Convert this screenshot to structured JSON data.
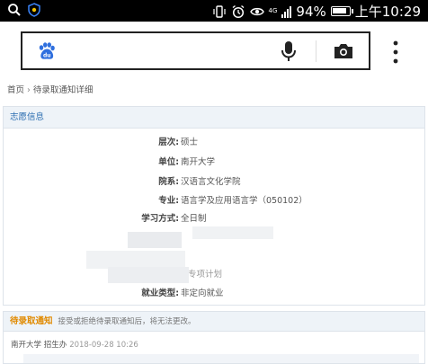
{
  "statusbar": {
    "battery": "94%",
    "battery_level": 0.94,
    "time": "上午10:29",
    "network": "4G",
    "icons": [
      "search-icon",
      "shield-icon",
      "vibrate-icon",
      "alarm-icon",
      "eye-icon",
      "signal-icon",
      "battery-icon"
    ]
  },
  "searchbar": {
    "logo": "baidu-logo",
    "icons": [
      "microphone-icon",
      "camera-icon",
      "more-vertical-icon"
    ]
  },
  "breadcrumb": {
    "home": "首页",
    "separator": "›",
    "current": "待录取通知详细"
  },
  "volunteer_panel": {
    "title": "志愿信息",
    "rows": [
      {
        "label": "层次:",
        "value": "硕士"
      },
      {
        "label": "单位:",
        "value": "南开大学"
      },
      {
        "label": "院系:",
        "value": "汉语言文化学院"
      },
      {
        "label": "专业:",
        "value": "语言学及应用语言学（050102）"
      },
      {
        "label": "学习方式:",
        "value": "全日制"
      },
      {
        "label": "",
        "value": "专项计划"
      },
      {
        "label": "就业类型:",
        "value": "非定向就业"
      }
    ]
  },
  "admission_panel": {
    "title": "待录取通知",
    "note": "接受或拒绝待录取通知后，将无法更改。",
    "from": "南开大学 招生办",
    "datetime": "2018-09-28 10:26"
  },
  "colors": {
    "panel_title": "#2a6cb0",
    "notice_title": "#e08a00",
    "panel_header_bg": "#eef3f8"
  }
}
